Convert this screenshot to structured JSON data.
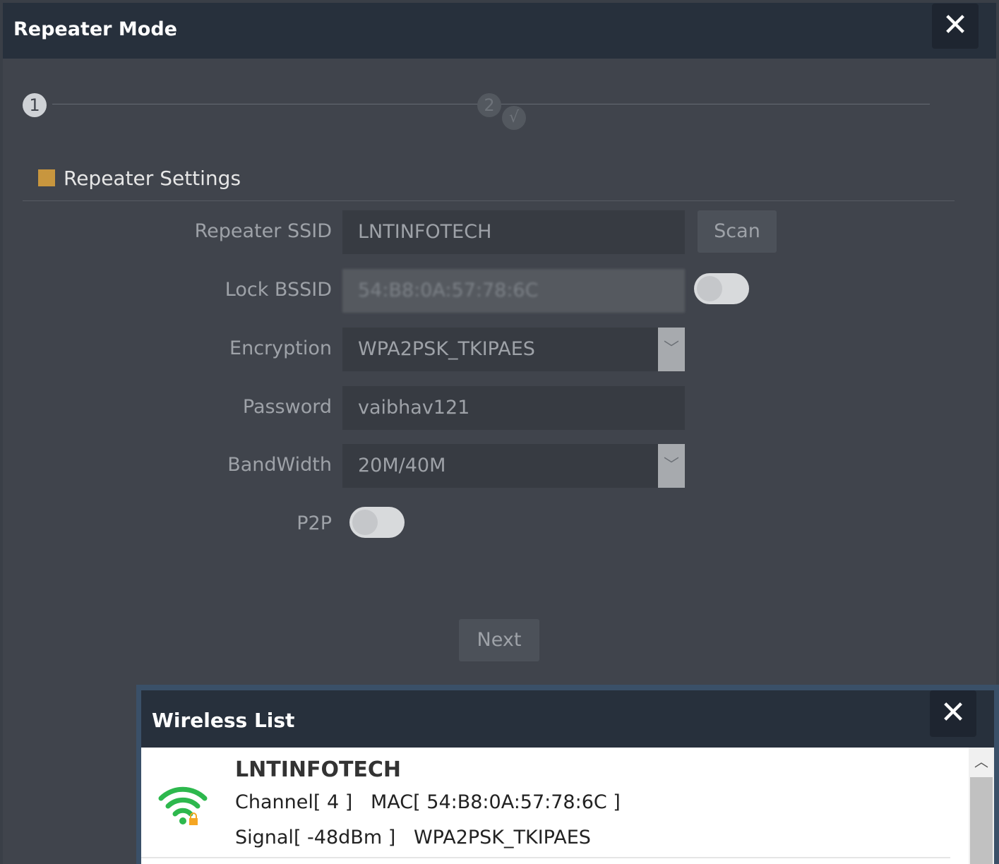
{
  "dialog": {
    "title": "Repeater Mode",
    "close_icon": "close-icon"
  },
  "steps": {
    "step1": "1",
    "step2": "2",
    "step2_check": "√"
  },
  "section": {
    "title": "Repeater Settings",
    "marker_color": "#c8963e"
  },
  "form": {
    "ssid": {
      "label": "Repeater SSID",
      "value": "LNTINFOTECH"
    },
    "scan_label": "Scan",
    "lock_bssid": {
      "label": "Lock BSSID",
      "value": "54:B8:0A:57:78:6C",
      "toggle_on": false
    },
    "encryption": {
      "label": "Encryption",
      "value": "WPA2PSK_TKIPAES"
    },
    "password": {
      "label": "Password",
      "value": "vaibhav121"
    },
    "bandwidth": {
      "label": "BandWidth",
      "value": "20M/40M"
    },
    "p2p": {
      "label": "P2P",
      "toggle_on": false
    },
    "next_label": "Next"
  },
  "wireless_list": {
    "title": "Wireless List",
    "items": [
      {
        "ssid": "LNTINFOTECH",
        "channel_mac": "Channel[ 4 ]   MAC[ 54:B8:0A:57:78:6C ]",
        "signal_enc": "Signal[ -48dBm ]   WPA2PSK_TKIPAES",
        "icon": "wifi-locked-icon",
        "signal_color": "#2db84d",
        "lock_color": "#f5a623"
      }
    ]
  }
}
